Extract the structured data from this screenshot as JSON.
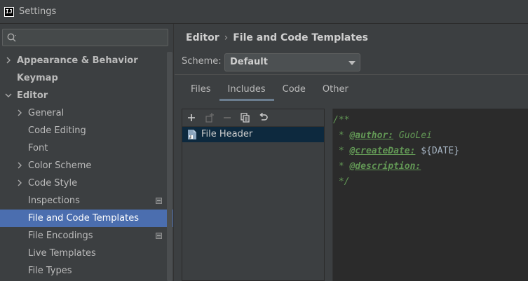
{
  "window": {
    "title": "Settings"
  },
  "search": {
    "placeholder": ""
  },
  "sidebar": {
    "items": [
      {
        "label": "Appearance & Behavior"
      },
      {
        "label": "Keymap"
      },
      {
        "label": "Editor"
      },
      {
        "label": "General"
      },
      {
        "label": "Code Editing"
      },
      {
        "label": "Font"
      },
      {
        "label": "Color Scheme"
      },
      {
        "label": "Code Style"
      },
      {
        "label": "Inspections"
      },
      {
        "label": "File and Code Templates"
      },
      {
        "label": "File Encodings"
      },
      {
        "label": "Live Templates"
      },
      {
        "label": "File Types"
      }
    ],
    "selected": "File and Code Templates"
  },
  "breadcrumb": {
    "parent": "Editor",
    "separator": "›",
    "current": "File and Code Templates"
  },
  "scheme": {
    "label": "Scheme:",
    "value": "Default"
  },
  "tabs": [
    {
      "label": "Files"
    },
    {
      "label": "Includes"
    },
    {
      "label": "Code"
    },
    {
      "label": "Other"
    }
  ],
  "active_tab": "Includes",
  "templates": {
    "items": [
      {
        "label": "File Header"
      }
    ]
  },
  "editor": {
    "lines": {
      "l1": "/**",
      "l2_prefix": " * ",
      "l2_tag": "@author:",
      "l2_value": " GuoLei",
      "l3_prefix": " * ",
      "l3_tag": "@createDate:",
      "l3_space": " ",
      "l3_var": "${DATE}",
      "l4_prefix": " * ",
      "l4_tag": "@description:",
      "l5": " */"
    }
  },
  "colors": {
    "background": "#3c3f41",
    "selection": "#4b6eaf",
    "editor_bg": "#2b2b2b",
    "doc_comment": "#629755",
    "list_selection": "#0d293e"
  },
  "icons": {
    "app": "intellij-icon",
    "search": "search-icon",
    "add": "plus-icon",
    "add_child": "add-child-icon",
    "remove": "minus-icon",
    "copy": "copy-icon",
    "reset": "undo-icon",
    "file": "file-template-icon"
  }
}
